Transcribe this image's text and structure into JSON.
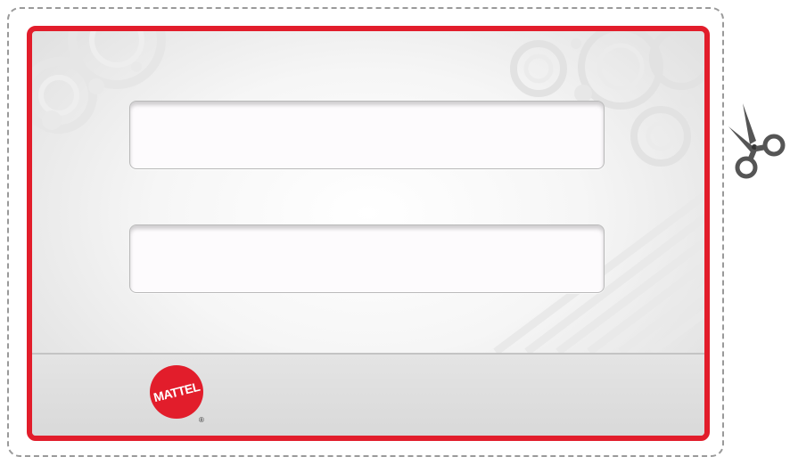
{
  "colors": {
    "card_border": "#e21d2b",
    "cut_line": "#9a9a9a",
    "field_background": "#fdfbfd",
    "footer_background": "#dedede",
    "logo_red": "#e21d2b"
  },
  "fields": [
    {
      "value": "",
      "placeholder": ""
    },
    {
      "value": "",
      "placeholder": ""
    }
  ],
  "footer": {
    "logo": {
      "text": "MATTEL",
      "registered_mark": "®"
    }
  },
  "icons": {
    "cut_marker": "scissors-icon",
    "logo": "mattel-logo"
  }
}
